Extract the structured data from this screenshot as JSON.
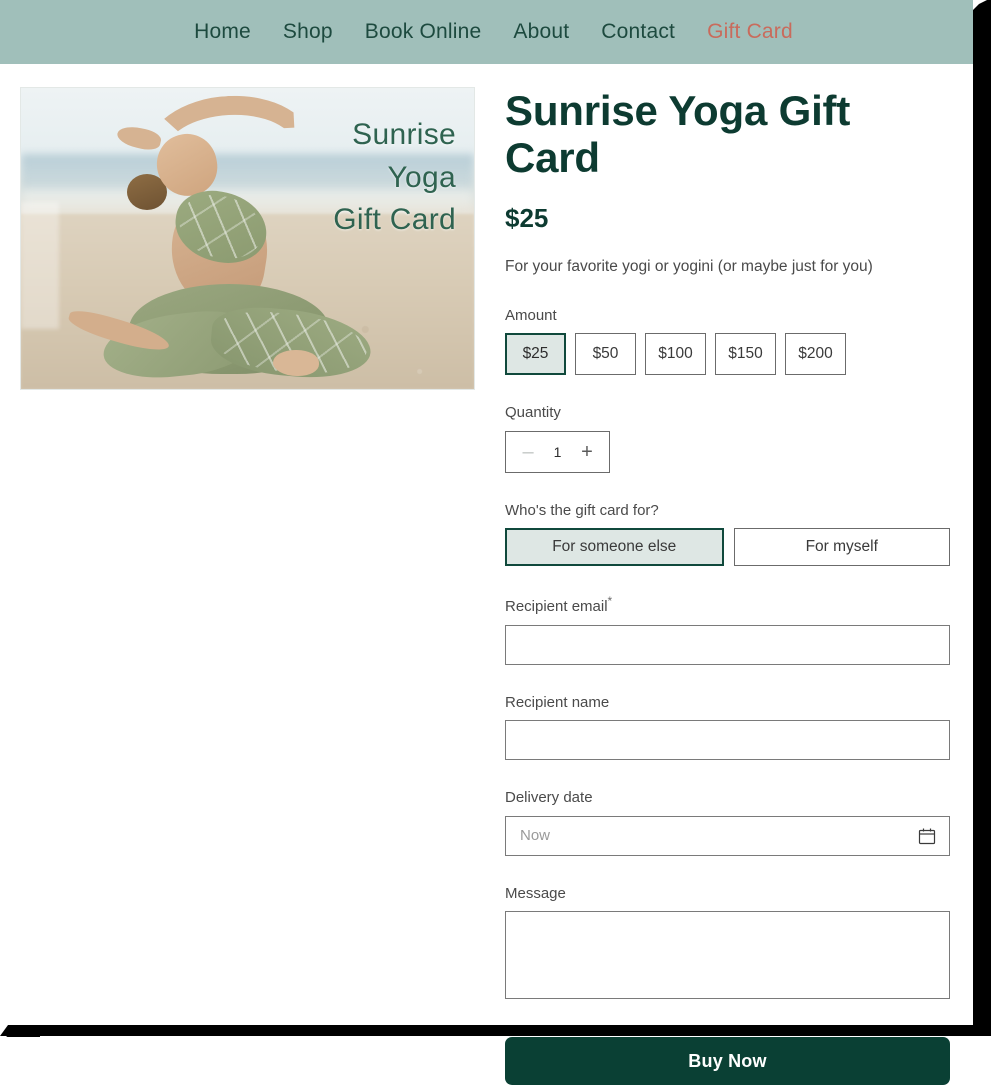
{
  "nav": {
    "items": [
      {
        "label": "Home",
        "accent": false
      },
      {
        "label": "Shop",
        "accent": false
      },
      {
        "label": "Book Online",
        "accent": false
      },
      {
        "label": "About",
        "accent": false
      },
      {
        "label": "Contact",
        "accent": false
      },
      {
        "label": "Gift Card",
        "accent": true
      }
    ],
    "bg_color": "#a0bfba",
    "text_color": "#1d4a3f",
    "accent_color": "#c96b5c"
  },
  "product_image": {
    "alt": "Woman in green patterned yoga outfit doing a seated side-bend on a beach",
    "overlay_lines": [
      "Sunrise",
      "Yoga",
      "Gift Card"
    ],
    "overlay_color": "#2f6350"
  },
  "product": {
    "title": "Sunrise Yoga Gift Card",
    "price": "$25",
    "subtitle": "For your favorite yogi or yogini (or maybe just for you)"
  },
  "amount": {
    "label": "Amount",
    "options": [
      "$25",
      "$50",
      "$100",
      "$150",
      "$200"
    ],
    "selected": "$25"
  },
  "quantity": {
    "label": "Quantity",
    "value": "1",
    "minus": "–",
    "plus": "+",
    "minus_disabled": true
  },
  "recipient_choice": {
    "label": "Who's the gift card for?",
    "options": [
      "For someone else",
      "For myself"
    ],
    "selected": "For someone else"
  },
  "form": {
    "recipient_email": {
      "label": "Recipient email",
      "required_marker": "*",
      "value": "",
      "placeholder": ""
    },
    "recipient_name": {
      "label": "Recipient name",
      "value": "",
      "placeholder": ""
    },
    "delivery_date": {
      "label": "Delivery date",
      "value": "",
      "placeholder": "Now",
      "icon": "calendar-icon"
    },
    "message": {
      "label": "Message",
      "value": "",
      "placeholder": ""
    }
  },
  "cta": {
    "buy_label": "Buy Now",
    "color": "#0a4034"
  }
}
